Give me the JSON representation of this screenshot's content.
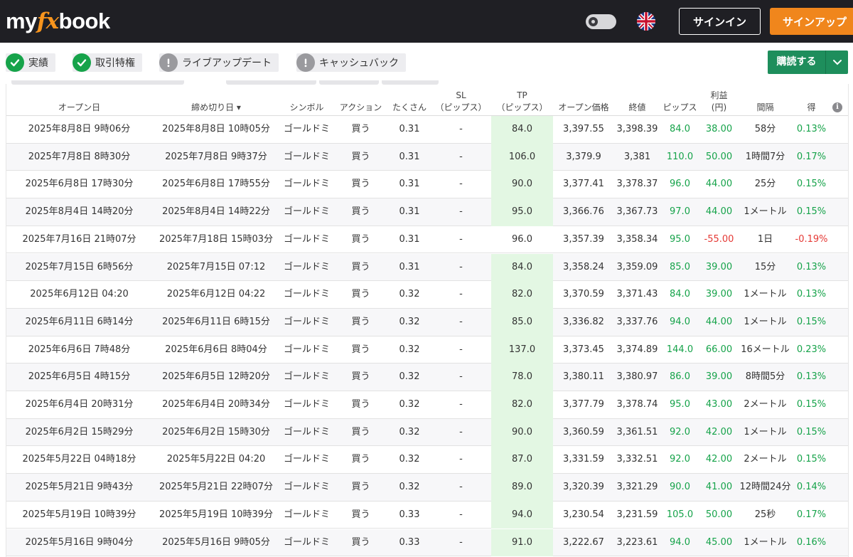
{
  "header": {
    "logo": {
      "part1": "my",
      "part2": "fx",
      "part3": "book"
    },
    "signin_label": "サインイン",
    "signup_label": "サインアップ",
    "language_icon": "uk-flag-icon",
    "theme_toggle_icon": "dark-mode-toggle-icon"
  },
  "badges": [
    {
      "label": "実績",
      "icon": "check-circle-icon",
      "status": "verified"
    },
    {
      "label": "取引特権",
      "icon": "check-circle-icon",
      "status": "verified"
    },
    {
      "label": "ライブアップデート",
      "icon": "exclamation-circle-icon",
      "status": "unverified"
    },
    {
      "label": "キャッシュバック",
      "icon": "exclamation-circle-icon",
      "status": "unverified"
    }
  ],
  "buy_button": {
    "label": "購読する",
    "icon": "chevron-down-icon"
  },
  "colors": {
    "header_bg": "#1f1f24",
    "accent_orange": "#f0861c",
    "buy_green": "#1e8e5c",
    "positive": "#16a34a",
    "negative": "#e53935",
    "tp_highlight": "#e3f7e3"
  },
  "table": {
    "columns": [
      {
        "key": "open_date",
        "label": "オープン日",
        "sub": ""
      },
      {
        "key": "close_date",
        "label": "締め切り日 ▾",
        "sub": ""
      },
      {
        "key": "symbol",
        "label": "シンボル",
        "sub": ""
      },
      {
        "key": "action",
        "label": "アクション",
        "sub": ""
      },
      {
        "key": "lots",
        "label": "たくさん",
        "sub": ""
      },
      {
        "key": "sl",
        "label": "SL",
        "sub": "（ピップス）"
      },
      {
        "key": "tp",
        "label": "TP",
        "sub": "（ピップス）"
      },
      {
        "key": "open_price",
        "label": "オープン価格",
        "sub": ""
      },
      {
        "key": "close_price",
        "label": "終値",
        "sub": ""
      },
      {
        "key": "pips",
        "label": "ピップス",
        "sub": ""
      },
      {
        "key": "profit",
        "label": "利益",
        "sub": "(円)"
      },
      {
        "key": "duration",
        "label": "間隔",
        "sub": ""
      },
      {
        "key": "gain",
        "label": "得",
        "sub": ""
      }
    ],
    "rows": [
      {
        "open_date": "2025年8月8日 9時06分",
        "close_date": "2025年8月8日 10時05分",
        "symbol": "ゴールドミ",
        "action": "買う",
        "lots": "0.31",
        "sl": "-",
        "tp": "84.0",
        "open_price": "3,397.55",
        "close_price": "3,398.39",
        "pips": "84.0",
        "profit": "38.00",
        "duration": "58分",
        "gain": "0.13%",
        "tp_hl": true,
        "neg": false
      },
      {
        "open_date": "2025年7月8日 8時30分",
        "close_date": "2025年7月8日 9時37分",
        "symbol": "ゴールドミ",
        "action": "買う",
        "lots": "0.31",
        "sl": "-",
        "tp": "106.0",
        "open_price": "3,379.9",
        "close_price": "3,381",
        "pips": "110.0",
        "profit": "50.00",
        "duration": "1時間7分",
        "gain": "0.17%",
        "tp_hl": true,
        "neg": false
      },
      {
        "open_date": "2025年6月8日 17時30分",
        "close_date": "2025年6月8日 17時55分",
        "symbol": "ゴールドミ",
        "action": "買う",
        "lots": "0.31",
        "sl": "-",
        "tp": "90.0",
        "open_price": "3,377.41",
        "close_price": "3,378.37",
        "pips": "96.0",
        "profit": "44.00",
        "duration": "25分",
        "gain": "0.15%",
        "tp_hl": true,
        "neg": false
      },
      {
        "open_date": "2025年8月4日 14時20分",
        "close_date": "2025年8月4日 14時22分",
        "symbol": "ゴールドミ",
        "action": "買う",
        "lots": "0.31",
        "sl": "-",
        "tp": "95.0",
        "open_price": "3,366.76",
        "close_price": "3,367.73",
        "pips": "97.0",
        "profit": "44.00",
        "duration": "1メートル",
        "gain": "0.15%",
        "tp_hl": true,
        "neg": false
      },
      {
        "open_date": "2025年7月16日 21時07分",
        "close_date": "2025年7月18日 15時03分",
        "symbol": "ゴールドミ",
        "action": "買う",
        "lots": "0.31",
        "sl": "-",
        "tp": "96.0",
        "open_price": "3,357.39",
        "close_price": "3,358.34",
        "pips": "95.0",
        "profit": "-55.00",
        "duration": "1日",
        "gain": "-0.19%",
        "tp_hl": false,
        "neg": true
      },
      {
        "open_date": "2025年7月15日 6時56分",
        "close_date": "2025年7月15日 07:12",
        "symbol": "ゴールドミ",
        "action": "買う",
        "lots": "0.31",
        "sl": "-",
        "tp": "84.0",
        "open_price": "3,358.24",
        "close_price": "3,359.09",
        "pips": "85.0",
        "profit": "39.00",
        "duration": "15分",
        "gain": "0.13%",
        "tp_hl": true,
        "neg": false
      },
      {
        "open_date": "2025年6月12日 04:20",
        "close_date": "2025年6月12日 04:22",
        "symbol": "ゴールドミ",
        "action": "買う",
        "lots": "0.32",
        "sl": "-",
        "tp": "82.0",
        "open_price": "3,370.59",
        "close_price": "3,371.43",
        "pips": "84.0",
        "profit": "39.00",
        "duration": "1メートル",
        "gain": "0.13%",
        "tp_hl": true,
        "neg": false
      },
      {
        "open_date": "2025年6月11日 6時14分",
        "close_date": "2025年6月11日 6時15分",
        "symbol": "ゴールドミ",
        "action": "買う",
        "lots": "0.32",
        "sl": "-",
        "tp": "85.0",
        "open_price": "3,336.82",
        "close_price": "3,337.76",
        "pips": "94.0",
        "profit": "44.00",
        "duration": "1メートル",
        "gain": "0.15%",
        "tp_hl": true,
        "neg": false
      },
      {
        "open_date": "2025年6月6日 7時48分",
        "close_date": "2025年6月6日 8時04分",
        "symbol": "ゴールドミ",
        "action": "買う",
        "lots": "0.32",
        "sl": "-",
        "tp": "137.0",
        "open_price": "3,373.45",
        "close_price": "3,374.89",
        "pips": "144.0",
        "profit": "66.00",
        "duration": "16メートル",
        "gain": "0.23%",
        "tp_hl": true,
        "neg": false
      },
      {
        "open_date": "2025年6月5日 4時15分",
        "close_date": "2025年6月5日 12時20分",
        "symbol": "ゴールドミ",
        "action": "買う",
        "lots": "0.32",
        "sl": "-",
        "tp": "78.0",
        "open_price": "3,380.11",
        "close_price": "3,380.97",
        "pips": "86.0",
        "profit": "39.00",
        "duration": "8時間5分",
        "gain": "0.13%",
        "tp_hl": true,
        "neg": false
      },
      {
        "open_date": "2025年6月4日 20時31分",
        "close_date": "2025年6月4日 20時34分",
        "symbol": "ゴールドミ",
        "action": "買う",
        "lots": "0.32",
        "sl": "-",
        "tp": "82.0",
        "open_price": "3,377.79",
        "close_price": "3,378.74",
        "pips": "95.0",
        "profit": "43.00",
        "duration": "2メートル",
        "gain": "0.15%",
        "tp_hl": true,
        "neg": false
      },
      {
        "open_date": "2025年6月2日 15時29分",
        "close_date": "2025年6月2日 15時30分",
        "symbol": "ゴールドミ",
        "action": "買う",
        "lots": "0.32",
        "sl": "-",
        "tp": "90.0",
        "open_price": "3,360.59",
        "close_price": "3,361.51",
        "pips": "92.0",
        "profit": "42.00",
        "duration": "1メートル",
        "gain": "0.15%",
        "tp_hl": true,
        "neg": false
      },
      {
        "open_date": "2025年5月22日 04時18分",
        "close_date": "2025年5月22日 04:20",
        "symbol": "ゴールドミ",
        "action": "買う",
        "lots": "0.32",
        "sl": "-",
        "tp": "87.0",
        "open_price": "3,331.59",
        "close_price": "3,332.51",
        "pips": "92.0",
        "profit": "42.00",
        "duration": "2メートル",
        "gain": "0.15%",
        "tp_hl": true,
        "neg": false
      },
      {
        "open_date": "2025年5月21日 9時43分",
        "close_date": "2025年5月21日 22時07分",
        "symbol": "ゴールドミ",
        "action": "買う",
        "lots": "0.32",
        "sl": "-",
        "tp": "89.0",
        "open_price": "3,320.39",
        "close_price": "3,321.29",
        "pips": "90.0",
        "profit": "41.00",
        "duration": "12時間24分",
        "gain": "0.14%",
        "tp_hl": true,
        "neg": false
      },
      {
        "open_date": "2025年5月19日 10時39分",
        "close_date": "2025年5月19日 10時39分",
        "symbol": "ゴールドミ",
        "action": "買う",
        "lots": "0.33",
        "sl": "-",
        "tp": "94.0",
        "open_price": "3,230.54",
        "close_price": "3,231.59",
        "pips": "105.0",
        "profit": "50.00",
        "duration": "25秒",
        "gain": "0.17%",
        "tp_hl": true,
        "neg": false
      },
      {
        "open_date": "2025年5月16日 9時04分",
        "close_date": "2025年5月16日 9時05分",
        "symbol": "ゴールドミ",
        "action": "買う",
        "lots": "0.33",
        "sl": "-",
        "tp": "91.0",
        "open_price": "3,222.67",
        "close_price": "3,223.61",
        "pips": "94.0",
        "profit": "45.00",
        "duration": "1メートル",
        "gain": "0.16%",
        "tp_hl": true,
        "neg": false
      }
    ]
  }
}
